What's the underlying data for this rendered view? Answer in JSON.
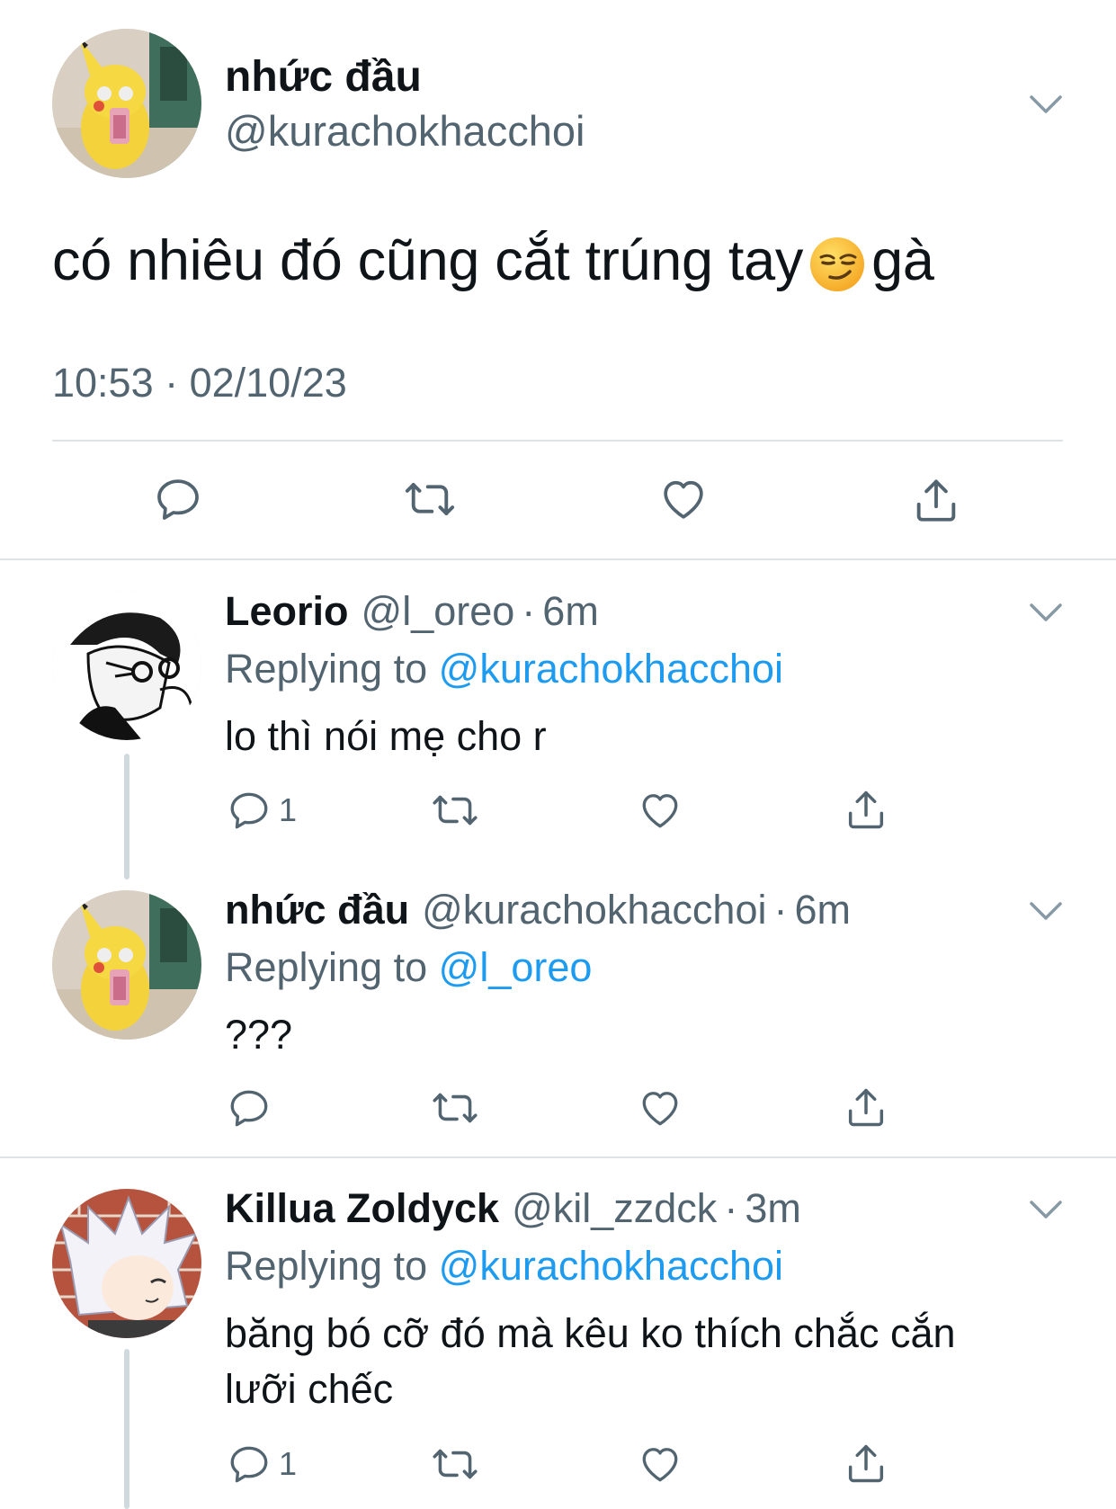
{
  "main_tweet": {
    "name": "nhức đầu",
    "handle": "@kurachokhacchoi",
    "text_before": "có nhiêu đó cũng cắt trúng tay",
    "emoji": "smirking-face-emoji",
    "text_after": "gà",
    "timestamp": "10:53 · 02/10/23"
  },
  "replies": [
    {
      "name": "Leorio",
      "handle": "@l_oreo",
      "dot": "·",
      "time": "6m",
      "replying_label": "Replying to",
      "replying_to": "@kurachokhacchoi",
      "text": "lo thì nói mẹ cho r",
      "reply_count": "1"
    },
    {
      "name": "nhức đầu",
      "handle": "@kurachokhacchoi",
      "dot": "·",
      "time": "6m",
      "replying_label": "Replying to",
      "replying_to": "@l_oreo",
      "text": "???",
      "reply_count": ""
    },
    {
      "name": "Killua Zoldyck",
      "handle": "@kil_zzdck",
      "dot": "·",
      "time": "3m",
      "replying_label": "Replying to",
      "replying_to": "@kurachokhacchoi",
      "text_line1": "băng bó cỡ đó mà kêu ko thích chắc cắn",
      "text_line2": "lưỡi chếc",
      "reply_count": "1"
    }
  ],
  "colors": {
    "accent": "#1d9bf0",
    "secondary_text": "#536471",
    "divider": "#dfe3e6"
  }
}
